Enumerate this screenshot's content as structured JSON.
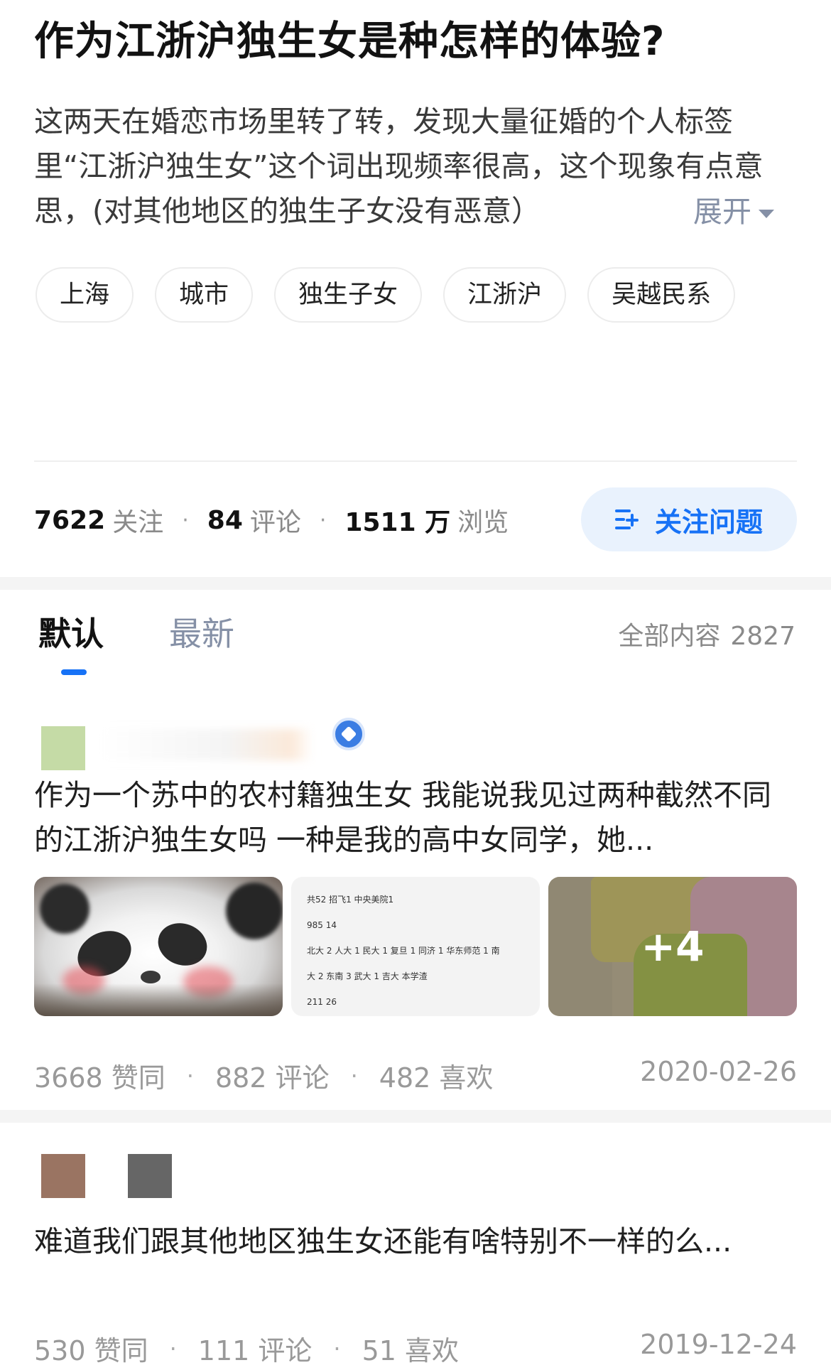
{
  "question": {
    "title": "作为江浙沪独生女是种怎样的体验?",
    "description": "这两天在婚恋市场里转了转，发现大量征婚的个人标签里“江浙沪独生女”这个词出现频率很高，这个现象有点意思，(对其他地区的独生子女没有恶意）",
    "expand_label": "展开",
    "tags": [
      "上海",
      "城市",
      "独生子女",
      "江浙沪",
      "吴越民系"
    ],
    "stats": {
      "followers": "7622",
      "followers_label": "关注",
      "comments": "84",
      "comments_label": "评论",
      "views": "1511 万",
      "views_label": "浏览"
    },
    "follow_button": "关注问题"
  },
  "tabs": {
    "default": "默认",
    "latest": "最新",
    "total_label": "全部内容",
    "total_count": "2827"
  },
  "answers": [
    {
      "excerpt": "作为一个苏中的农村籍独生女 我能说我见过两种截然不同的江浙沪独生女吗 一种是我的高中女同学，她...",
      "image_text_lines": [
        "共52 招飞1 中央美院1",
        "985 14",
        "北大 2 人大 1 民大 1 复旦 1 同济 1 华东师范 1 南",
        "大 2 东南 3 武大 1 吉大 本学渣",
        "211 26"
      ],
      "more_images": "+4",
      "agree": "3668 赞同",
      "comments": "882 评论",
      "likes": "482 喜欢",
      "date": "2020-02-26"
    },
    {
      "excerpt": "难道我们跟其他地区独生女还能有啥特别不一样的么...",
      "agree": "530 赞同",
      "comments": "111 评论",
      "likes": "51 喜欢",
      "date": "2019-12-24"
    }
  ]
}
